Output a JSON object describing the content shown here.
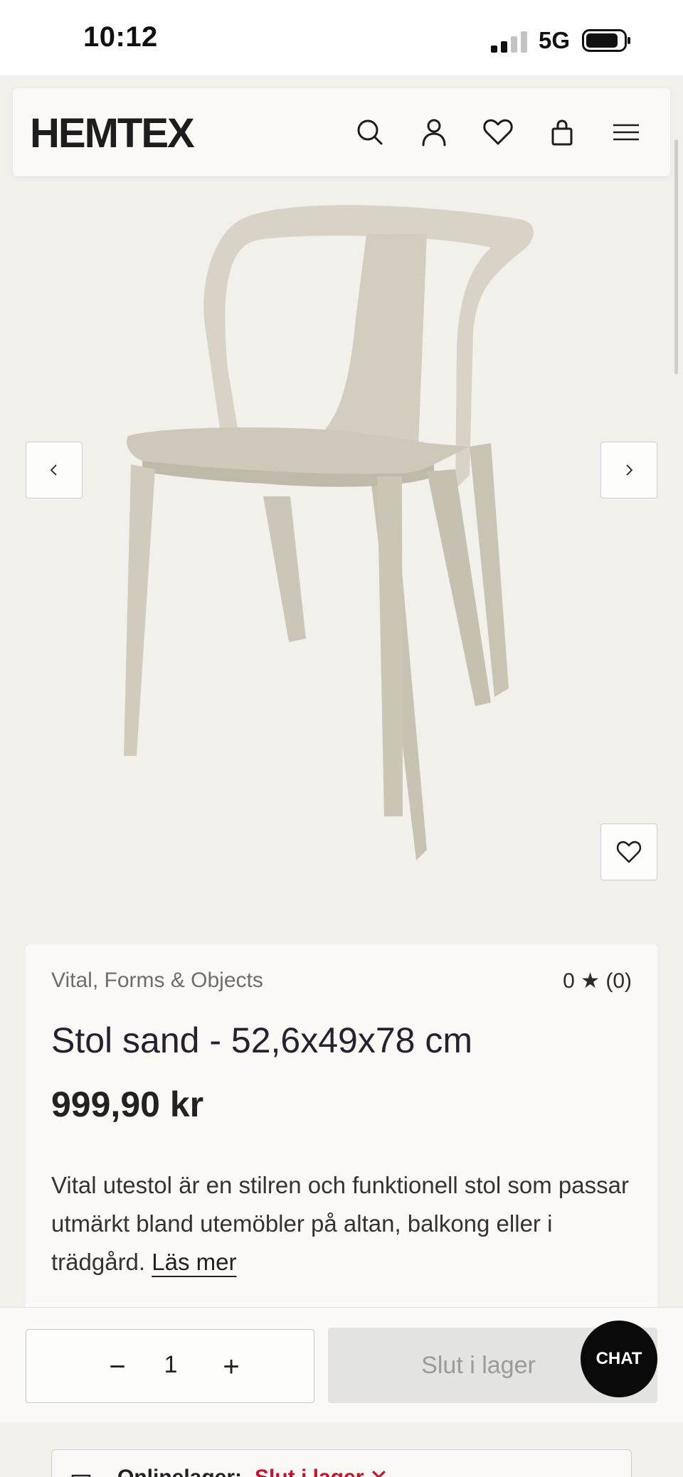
{
  "status_bar": {
    "time": "10:12",
    "network": "5G"
  },
  "header": {
    "logo": "HEMTEX",
    "icons": [
      "search-icon",
      "account-icon",
      "heart-icon",
      "bag-icon",
      "menu-icon"
    ]
  },
  "gallery": {
    "prev_icon": "chevron-left-icon",
    "next_icon": "chevron-right-icon",
    "favorite_icon": "heart-icon"
  },
  "product": {
    "brand": "Vital, Forms & Objects",
    "rating": "0 ★ (0)",
    "title": "Stol sand - 52,6x49x78 cm",
    "price": "999,90 kr",
    "description": "Vital utestol är en stilren och funktionell stol som passar utmärkt bland utemöbler på altan, balkong eller i trädgård.",
    "read_more": "Läs mer"
  },
  "purchase": {
    "minus": "−",
    "quantity": "1",
    "plus": "+",
    "stock_button": "Slut i lager",
    "chat": "CHAT"
  },
  "availability": {
    "label": "Onlinelager:",
    "status": "Slut i lager",
    "status_icon": "x-icon"
  },
  "colors": {
    "background": "#f2f0eb",
    "card": "#faf9f6",
    "chair": "#d6d1c4",
    "out_of_stock": "#c8102e"
  }
}
